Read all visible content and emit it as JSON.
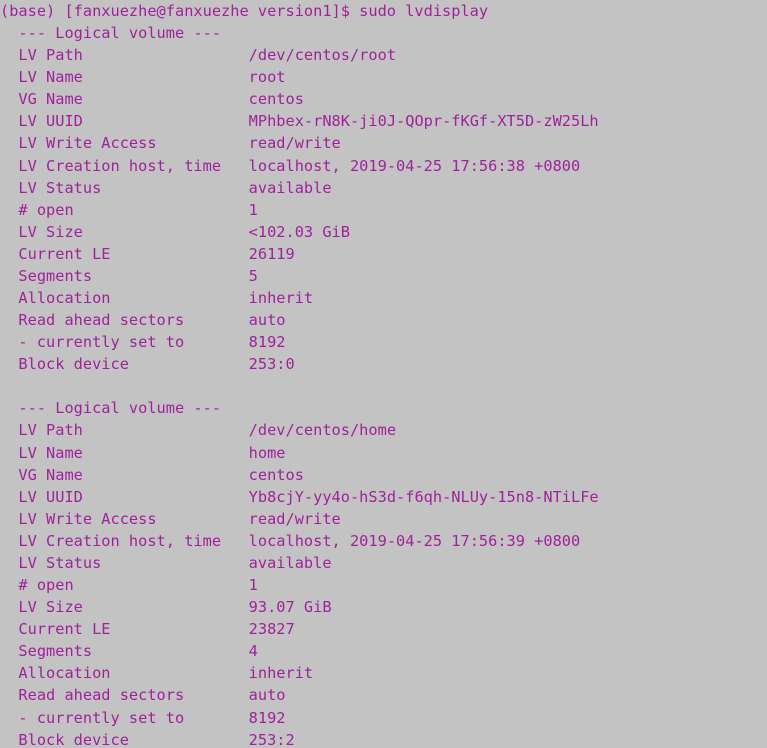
{
  "terminal": {
    "background_color": "#c3c3c3",
    "text_color": "#a0219b",
    "prompt_line": "(base) [fanxuezhe@fanxuezhe version1]$ sudo lvdisplay",
    "prompt_env": "(base)",
    "prompt_user": "fanxuezhe",
    "prompt_host": "fanxuezhe",
    "prompt_cwd": "version1",
    "prompt_symbol": "$",
    "command": "sudo lvdisplay",
    "section_header": "  --- Logical volume ---",
    "label_column_width": 25,
    "label_indent": "  ",
    "blocks": [
      {
        "header": "  --- Logical volume ---",
        "rows": [
          {
            "label": "LV Path",
            "value": "/dev/centos/root"
          },
          {
            "label": "LV Name",
            "value": "root"
          },
          {
            "label": "VG Name",
            "value": "centos"
          },
          {
            "label": "LV UUID",
            "value": "MPhbex-rN8K-ji0J-QOpr-fKGf-XT5D-zW25Lh"
          },
          {
            "label": "LV Write Access",
            "value": "read/write"
          },
          {
            "label": "LV Creation host, time",
            "value": "localhost, 2019-04-25 17:56:38 +0800"
          },
          {
            "label": "LV Status",
            "value": "available"
          },
          {
            "label": "# open",
            "value": "1"
          },
          {
            "label": "LV Size",
            "value": "<102.03 GiB"
          },
          {
            "label": "Current LE",
            "value": "26119"
          },
          {
            "label": "Segments",
            "value": "5"
          },
          {
            "label": "Allocation",
            "value": "inherit"
          },
          {
            "label": "Read ahead sectors",
            "value": "auto"
          },
          {
            "label": "- currently set to",
            "value": "8192"
          },
          {
            "label": "Block device",
            "value": "253:0"
          }
        ]
      },
      {
        "header": "  --- Logical volume ---",
        "rows": [
          {
            "label": "LV Path",
            "value": "/dev/centos/home"
          },
          {
            "label": "LV Name",
            "value": "home"
          },
          {
            "label": "VG Name",
            "value": "centos"
          },
          {
            "label": "LV UUID",
            "value": "Yb8cjY-yy4o-hS3d-f6qh-NLUy-15n8-NTiLFe"
          },
          {
            "label": "LV Write Access",
            "value": "read/write"
          },
          {
            "label": "LV Creation host, time",
            "value": "localhost, 2019-04-25 17:56:39 +0800"
          },
          {
            "label": "LV Status",
            "value": "available"
          },
          {
            "label": "# open",
            "value": "1"
          },
          {
            "label": "LV Size",
            "value": "93.07 GiB"
          },
          {
            "label": "Current LE",
            "value": "23827"
          },
          {
            "label": "Segments",
            "value": "4"
          },
          {
            "label": "Allocation",
            "value": "inherit"
          },
          {
            "label": "Read ahead sectors",
            "value": "auto"
          },
          {
            "label": "- currently set to",
            "value": "8192"
          },
          {
            "label": "Block device",
            "value": "253:2"
          }
        ]
      }
    ]
  }
}
